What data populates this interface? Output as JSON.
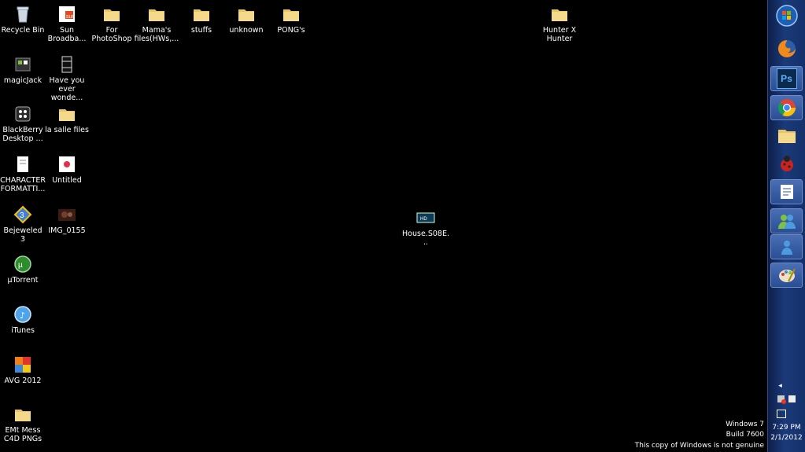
{
  "desktop": {
    "icons": [
      {
        "label": "Recycle Bin",
        "icon": "recycle-bin-icon"
      },
      {
        "label": "Sun\nBroadba...",
        "icon": "sun-broadband-icon"
      },
      {
        "label": "For\nPhotoShop",
        "icon": "folder-icon"
      },
      {
        "label": "Mama's\nfiles(HWs,...",
        "icon": "folder-icon"
      },
      {
        "label": "stuffs",
        "icon": "folder-icon"
      },
      {
        "label": "unknown",
        "icon": "folder-icon"
      },
      {
        "label": "PONG's",
        "icon": "folder-icon"
      },
      {
        "label": "Hunter X\nHunter",
        "icon": "folder-icon"
      },
      {
        "label": "magicJack",
        "icon": "magicjack-icon"
      },
      {
        "label": "Have you\never wonde...",
        "icon": "video-file-icon"
      },
      {
        "label": "BlackBerry\nDesktop ...",
        "icon": "blackberry-icon"
      },
      {
        "label": "la salle files",
        "icon": "folder-icon"
      },
      {
        "label": "CHARACTER\nFORMATTI...",
        "icon": "document-icon"
      },
      {
        "label": "Untitled",
        "icon": "image-file-icon"
      },
      {
        "label": "Bejeweled 3",
        "icon": "bejeweled-icon"
      },
      {
        "label": "IMG_0155",
        "icon": "photo-icon"
      },
      {
        "label": "House.S08E...",
        "icon": "video-icon"
      },
      {
        "label": "µTorrent",
        "icon": "utorrent-icon"
      },
      {
        "label": "iTunes",
        "icon": "itunes-icon"
      },
      {
        "label": "AVG 2012",
        "icon": "avg-icon"
      },
      {
        "label": "EMt Mess\nC4D PNGs",
        "icon": "folder-icon"
      }
    ]
  },
  "taskbar": {
    "buttons": [
      {
        "name": "start-button",
        "icon": "windows-orb-icon"
      },
      {
        "name": "firefox-button",
        "icon": "firefox-icon"
      },
      {
        "name": "photoshop-button",
        "icon": "photoshop-icon",
        "text": "Ps"
      },
      {
        "name": "chrome-button",
        "icon": "chrome-icon"
      },
      {
        "name": "explorer-button",
        "icon": "folder-icon"
      },
      {
        "name": "app-button",
        "icon": "ladybug-icon"
      },
      {
        "name": "word-button",
        "icon": "word-icon"
      },
      {
        "name": "messenger-button",
        "icon": "messenger-icon"
      },
      {
        "name": "messenger2-button",
        "icon": "messenger-icon"
      },
      {
        "name": "paint-button",
        "icon": "paint-icon"
      }
    ],
    "tray_arrow": "◂",
    "time": "7:29 PM",
    "date": "2/1/2012"
  },
  "watermark": {
    "line1": "Windows 7",
    "line2": "Build 7600",
    "line3": "This copy of Windows is not genuine"
  }
}
